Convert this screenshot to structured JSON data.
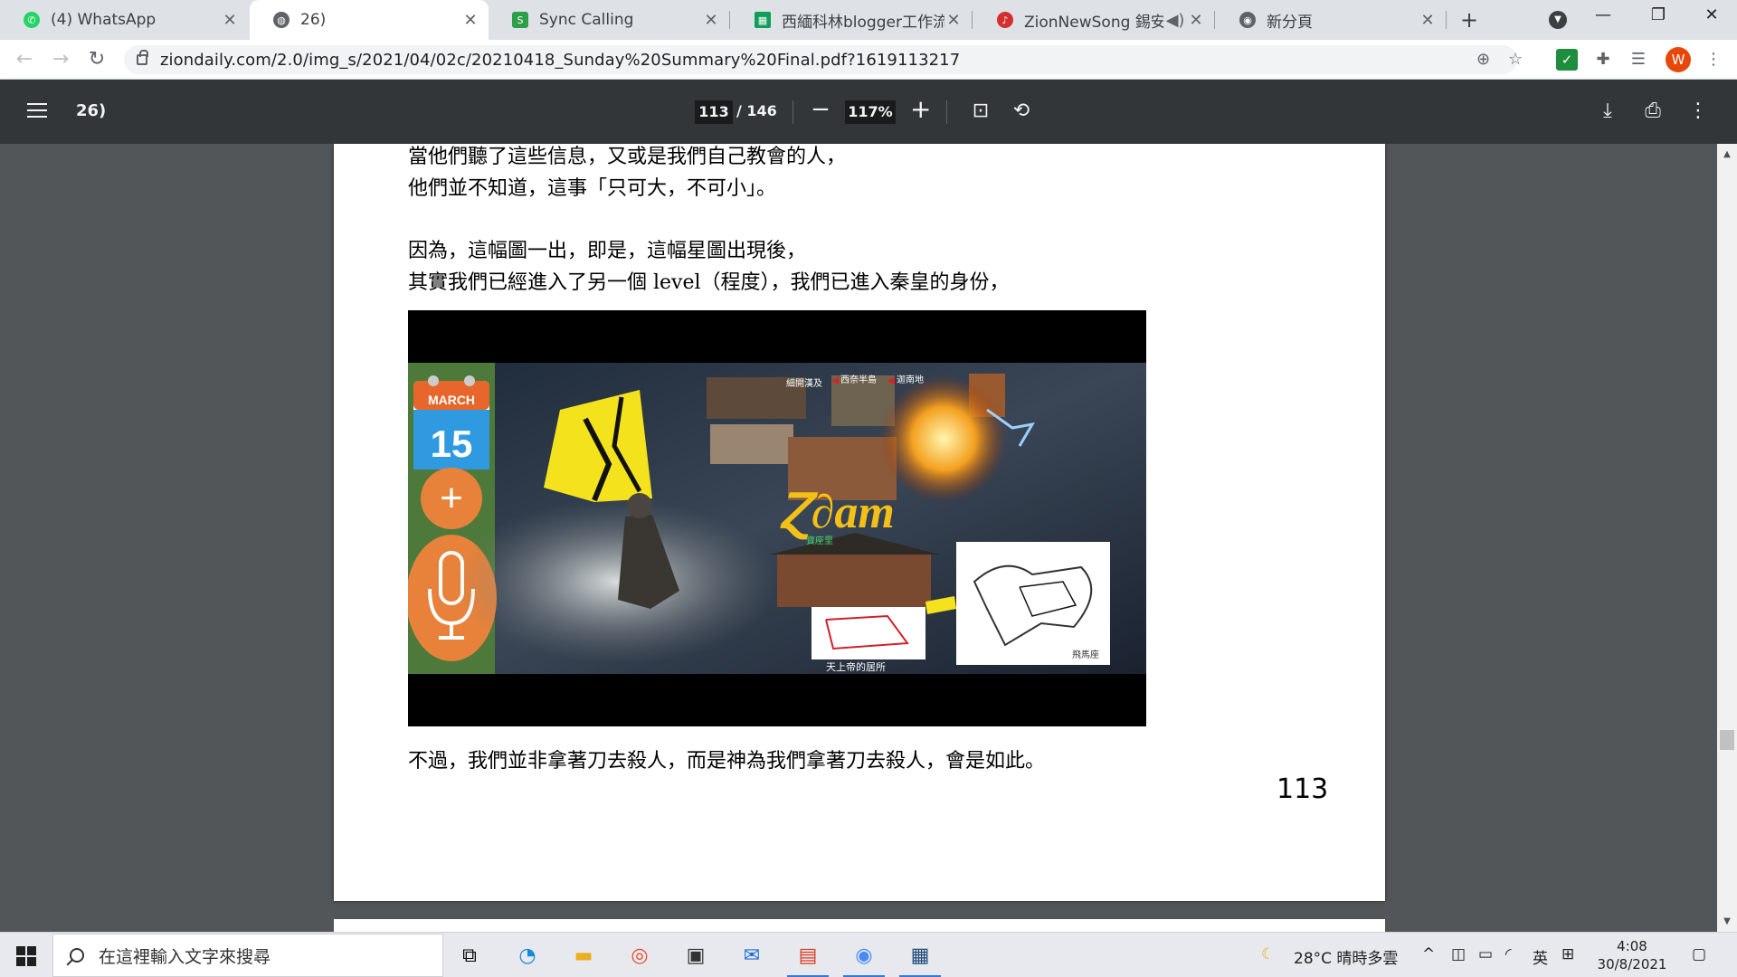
{
  "tabs": [
    {
      "label": "(4) WhatsApp",
      "icon": "whatsapp-icon",
      "color": "#25d366",
      "active": false
    },
    {
      "label": "26)",
      "icon": "globe-icon",
      "color": "#5f6368",
      "active": true
    },
    {
      "label": "Sync Calling",
      "icon": "sync-calling-icon",
      "color": "#2e9e48",
      "active": false
    },
    {
      "label": "西緬科林blogger工作流程",
      "icon": "sheets-icon",
      "color": "#0f9d58",
      "active": false
    },
    {
      "label": "ZionNewSong 錫安新",
      "icon": "zion-icon",
      "color": "#d32f2f",
      "active": false
    },
    {
      "label": "新分頁",
      "icon": "chrome-icon",
      "color": "#5f6368",
      "active": false
    }
  ],
  "address": {
    "url": "ziondaily.com/2.0/img_s/2021/04/02c/20210418_Sunday%20Summary%20Final.pdf?1619113217"
  },
  "pdf": {
    "title": "26)",
    "current_page": "113",
    "total_pages": "/ 146",
    "zoom": "117%"
  },
  "page": {
    "lines": [
      "當他們聽了這些信息，又或是我們自己教會的人，",
      "他們並不知道，這事「只可大，不可小」。",
      "因為，這幅圖一出，即是，這幅星圖出現後，",
      "其實我們已經進入了另一個  level（程度），我們已進入秦皇的身份，",
      "不過，我們並非拿著刀去殺人，而是神為我們拿著刀去殺人，會是如此。"
    ],
    "page_number": "113",
    "figure": {
      "calendar_month": "MARCH",
      "calendar_day": "15",
      "labels": [
        "細開漢及",
        "西奈半島",
        "迦南地",
        "寶座里",
        "天上帝的居所",
        "飛馬座"
      ]
    }
  },
  "taskbar": {
    "search_placeholder": "在這裡輸入文字來搜尋",
    "weather": "28°C  晴時多雲",
    "ime": "英",
    "time": "4:08",
    "date": "30/8/2021"
  }
}
